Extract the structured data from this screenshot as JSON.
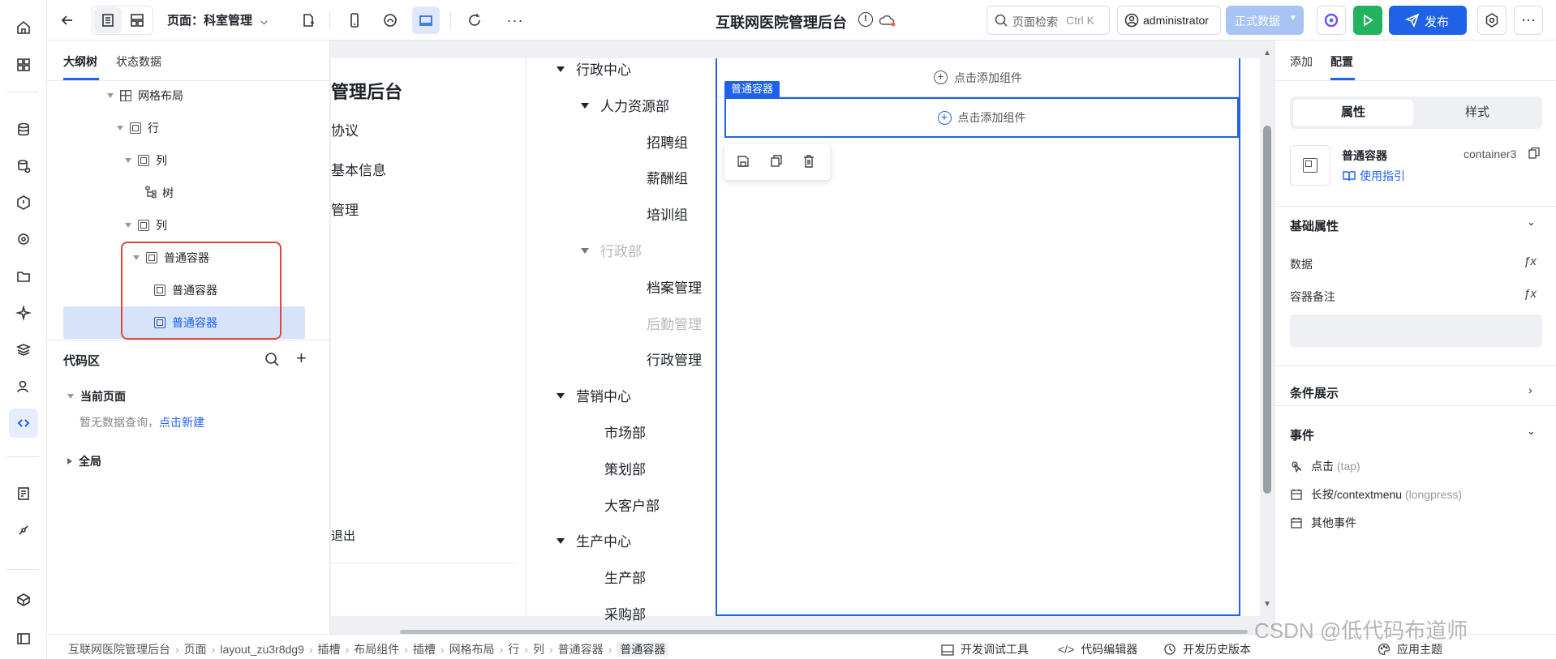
{
  "topbar": {
    "page_label": "页面：科室管理",
    "app_title": "互联网医院管理后台",
    "search_placeholder": "页面检索",
    "search_shortcut": "Ctrl K",
    "user": "administrator",
    "env_label": "正式数据",
    "publish_label": "发布"
  },
  "leftpanel": {
    "tabs": [
      "大纲树",
      "状态数据"
    ],
    "tree": {
      "grid": "网格布局",
      "row": "行",
      "col1": "列",
      "tree": "树",
      "col2": "列",
      "container": "普通容器",
      "child1": "普通容器",
      "child2": "普通容器"
    },
    "code_area": {
      "title": "代码区",
      "current_page": "当前页面",
      "empty_prefix": "暂无数据查询，",
      "empty_link": "点击新建",
      "global": "全局"
    }
  },
  "canvas": {
    "left_fragments": [
      "管理后台",
      "协议",
      "基本信息",
      "管理",
      "退出"
    ],
    "tree_nodes": [
      {
        "label": "行政中心",
        "level": 0,
        "caret": true,
        "muted": false
      },
      {
        "label": "人力资源部",
        "level": 1,
        "caret": true,
        "muted": false
      },
      {
        "label": "招聘组",
        "level": 2,
        "caret": false,
        "muted": false
      },
      {
        "label": "薪酬组",
        "level": 2,
        "caret": false,
        "muted": false
      },
      {
        "label": "培训组",
        "level": 2,
        "caret": false,
        "muted": false
      },
      {
        "label": "行政部",
        "level": 1,
        "caret": true,
        "muted": true
      },
      {
        "label": "档案管理",
        "level": 2,
        "caret": false,
        "muted": false
      },
      {
        "label": "后勤管理",
        "level": 2,
        "caret": false,
        "muted": true
      },
      {
        "label": "行政管理",
        "level": 2,
        "caret": false,
        "muted": false
      },
      {
        "label": "营销中心",
        "level": 0,
        "caret": true,
        "muted": false
      },
      {
        "label": "市场部",
        "level": 1,
        "caret": false,
        "muted": false
      },
      {
        "label": "策划部",
        "level": 1,
        "caret": false,
        "muted": false
      },
      {
        "label": "大客户部",
        "level": 1,
        "caret": false,
        "muted": false
      },
      {
        "label": "生产中心",
        "level": 0,
        "caret": true,
        "muted": false
      },
      {
        "label": "生产部",
        "level": 1,
        "caret": false,
        "muted": false
      },
      {
        "label": "采购部",
        "level": 1,
        "caret": false,
        "muted": false
      }
    ],
    "add_component": "点击添加组件",
    "container_tag": "普通容器"
  },
  "rightpanel": {
    "tabs": [
      "添加",
      "配置"
    ],
    "seg": [
      "属性",
      "样式"
    ],
    "component_name": "普通容器",
    "component_id": "container3",
    "guide_link": "使用指引",
    "basic_props": "基础属性",
    "prop_data": "数据",
    "prop_note": "容器备注",
    "conditional": "条件展示",
    "events": "事件",
    "event_tap": "点击",
    "event_tap_code": "(tap)",
    "event_long": "长按/contextmenu",
    "event_long_code": "(longpress)",
    "event_other": "其他事件"
  },
  "bottombar": {
    "breadcrumb": [
      "互联网医院管理后台",
      "页面",
      "layout_zu3r8dg9",
      "插槽",
      "布局组件",
      "插槽",
      "网格布局",
      "行",
      "列",
      "普通容器",
      "普通容器"
    ],
    "dev_tools": "开发调试工具",
    "code_editor": "代码编辑器",
    "history": "开发历史版本",
    "theme": "应用主题",
    "watermark": "CSDN @低代码布道师"
  },
  "colors": {
    "accent": "#1f62e8",
    "highlight_border": "#e0473a",
    "publish_green": "#22b35e"
  }
}
